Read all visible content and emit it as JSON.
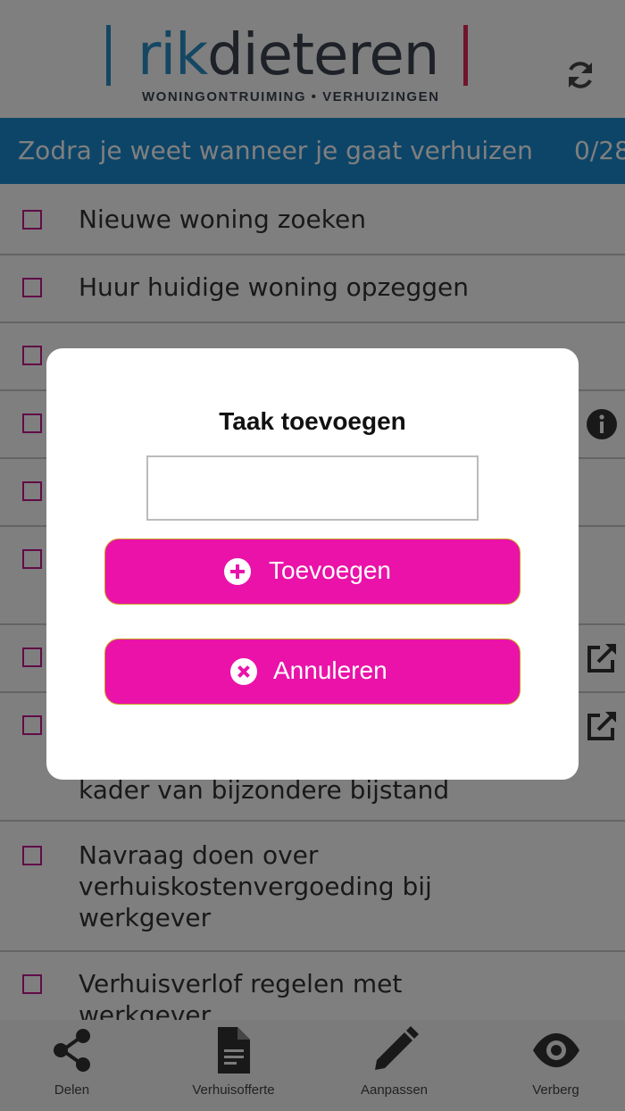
{
  "header": {
    "logo_part1": "rik",
    "logo_part2": "dieteren",
    "logo_tagline": "WONINGONTRUIMING • VERHUIZINGEN"
  },
  "banner": {
    "title": "Zodra je weet wanneer je gaat verhuizen",
    "count": "0/28"
  },
  "tasks": [
    {
      "label": "Nieuwe woning zoeken"
    },
    {
      "label": "Huur huidige woning opzeggen"
    },
    {
      "label": ""
    },
    {
      "label": ""
    },
    {
      "label": ""
    },
    {
      "label": ""
    },
    {
      "label": ""
    },
    {
      "label_line2": "kader van bijzondere bijstand"
    },
    {
      "label_lines": [
        "Navraag doen over",
        "verhuiskostenvergoeding bij",
        "werkgever"
      ]
    },
    {
      "label_lines": [
        "Verhuisverlof regelen met",
        "werkgever"
      ]
    }
  ],
  "modal": {
    "title": "Taak toevoegen",
    "input_value": "",
    "add_label": "Toevoegen",
    "cancel_label": "Annuleren"
  },
  "bottom_nav": [
    {
      "label": "Delen",
      "icon": "share-icon"
    },
    {
      "label": "Verhuisofferte",
      "icon": "document-icon"
    },
    {
      "label": "Aanpassen",
      "icon": "pencil-icon"
    },
    {
      "label": "Verberg",
      "icon": "eye-icon"
    }
  ],
  "colors": {
    "banner": "#1b8ad0",
    "checkbox": "#c2188f",
    "button": "#ea12a9",
    "logo_blue": "#2a8fc7",
    "logo_red": "#e02b5a"
  }
}
